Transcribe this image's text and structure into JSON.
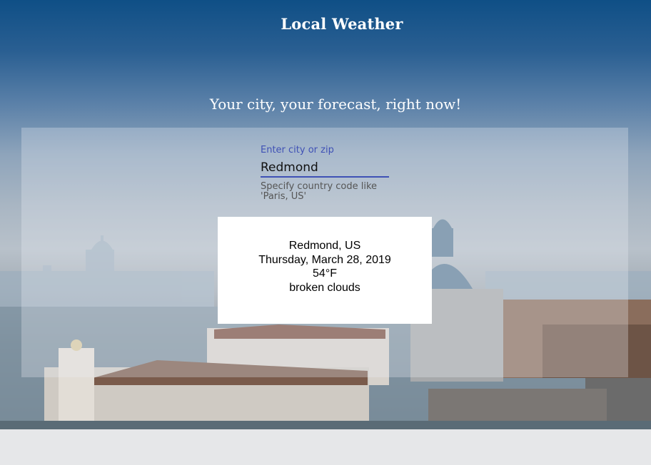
{
  "header": {
    "title": "Local Weather",
    "tagline": "Your city, your forecast, right now!"
  },
  "search": {
    "label": "Enter city or zip",
    "value": "Redmond",
    "hint": "Specify country code like 'Paris, US'"
  },
  "weather": {
    "location": "Redmond, US",
    "date": "Thursday, March 28, 2019",
    "temperature": "54°F",
    "description": "broken clouds"
  },
  "colors": {
    "accent": "#3f51b5",
    "sky_top": "#0f4f86",
    "footer": "#e6e7e9"
  }
}
